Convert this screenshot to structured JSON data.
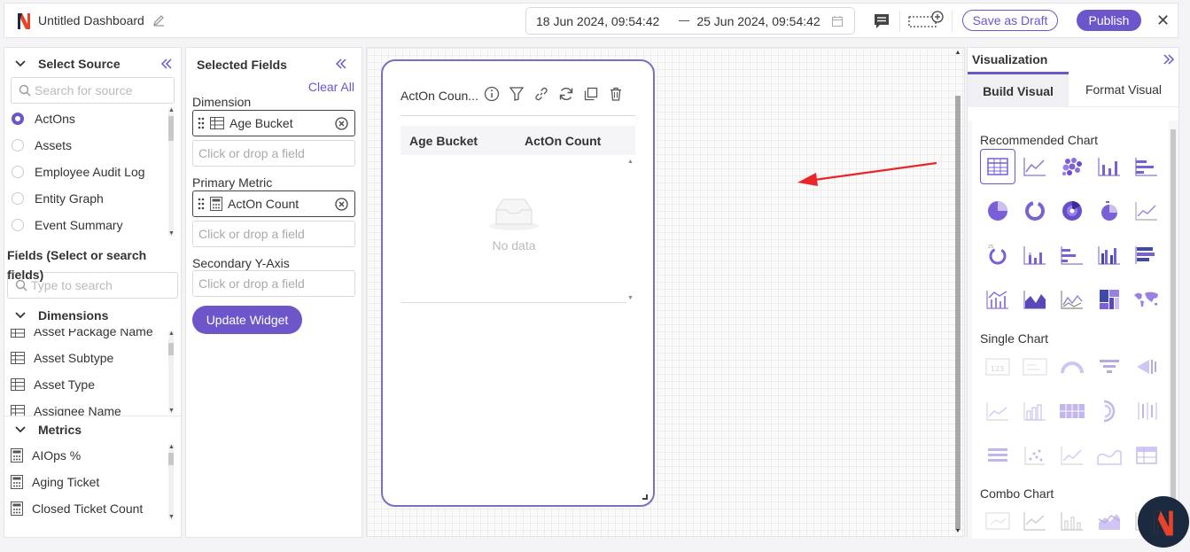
{
  "header": {
    "title": "Untitled Dashboard",
    "date_from": "18 Jun 2024, 09:54:42",
    "date_to": "25 Jun 2024, 09:54:42",
    "save_draft_label": "Save as Draft",
    "publish_label": "Publish",
    "close_label": "✕"
  },
  "source_panel": {
    "title": "Select Source",
    "search_placeholder": "Search for source",
    "sources": [
      {
        "label": "ActOns",
        "selected": true
      },
      {
        "label": "Assets",
        "selected": false
      },
      {
        "label": "Employee Audit Log",
        "selected": false
      },
      {
        "label": "Entity Graph",
        "selected": false
      },
      {
        "label": "Event Summary",
        "selected": false
      }
    ],
    "fields_title": "Fields (Select or search fields)",
    "fields_search_placeholder": "Type to search",
    "dimensions_title": "Dimensions",
    "dimensions": [
      "Asset Package Name",
      "Asset Subtype",
      "Asset Type",
      "Assignee Name"
    ],
    "metrics_title": "Metrics",
    "metrics": [
      "AIOps %",
      "Aging Ticket",
      "Closed Ticket Count"
    ]
  },
  "selected_fields": {
    "title": "Selected Fields",
    "clear_all": "Clear All",
    "dimension_label": "Dimension",
    "dimension_value": "Age Bucket",
    "primary_metric_label": "Primary Metric",
    "primary_metric_value": "ActOn Count",
    "secondary_label": "Secondary Y-Axis",
    "drop_placeholder": "Click or drop a field",
    "update_label": "Update Widget"
  },
  "widget": {
    "title": "ActOn Coun...",
    "columns": [
      "Age Bucket",
      "ActOn Count"
    ],
    "empty_text": "No data"
  },
  "visualization": {
    "title": "Visualization",
    "tabs": [
      "Build Visual",
      "Format Visual"
    ],
    "recommended_label": "Recommended Chart",
    "single_label": "Single Chart",
    "combo_label": "Combo Chart"
  },
  "colors": {
    "accent": "#6c56c9",
    "annotation": "#e8262a"
  }
}
